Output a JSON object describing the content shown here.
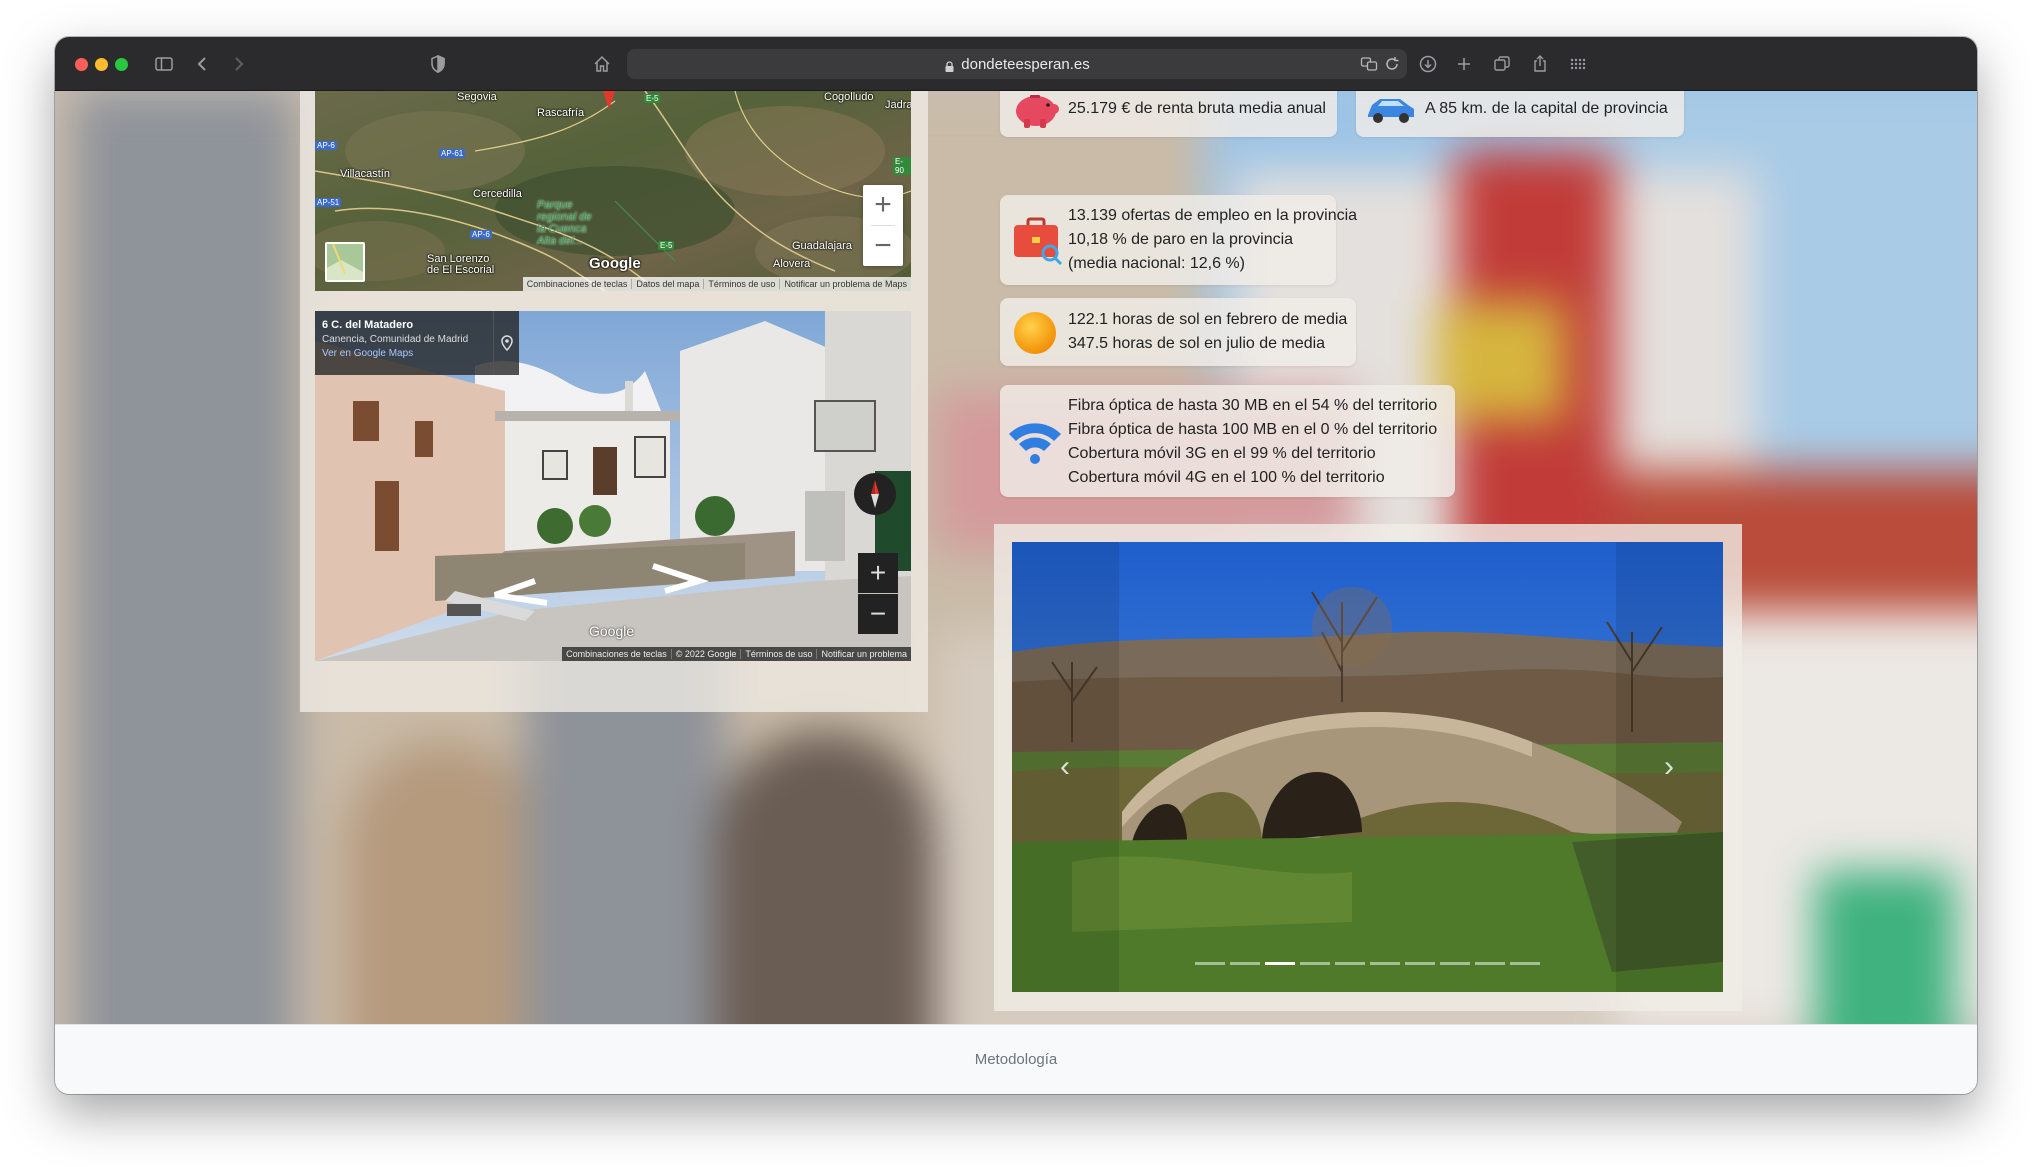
{
  "browser": {
    "url": "dondeteesperan.es"
  },
  "map": {
    "labels": {
      "segovia": "Segovia",
      "rascafria": "Rascafría",
      "cogolludo": "Cogolludo",
      "jadra": "Jadra",
      "villacastin": "Villacastín",
      "cercedilla": "Cercedilla",
      "parque": "Parque\nregional de\nla Cuenca\nAlta del...",
      "sanlorenzo": "San Lorenzo\nde El Escorial",
      "guadalajara": "Guadalajara",
      "alovera": "Alovera",
      "google": "Google"
    },
    "roads": {
      "ap6a": "AP-6",
      "ap61": "AP-61",
      "ap51": "AP-51",
      "ap6b": "AP-6",
      "e5a": "E-5",
      "e5b": "E-5",
      "e90": "E-90"
    },
    "zoom_in": "+",
    "zoom_out": "−",
    "footer": [
      "Combinaciones de teclas",
      "Datos del mapa",
      "Términos de uso",
      "Notificar un problema de Maps"
    ]
  },
  "streetview": {
    "title": "6 C. del Matadero",
    "subtitle": "Canencia, Comunidad de Madrid",
    "link": "Ver en Google Maps",
    "google": "Google",
    "zoom_in": "+",
    "zoom_out": "−",
    "footer": [
      "Combinaciones de teclas",
      "© 2022 Google",
      "Términos de uso",
      "Notificar un problema"
    ]
  },
  "cards": {
    "income": "25.179 € de renta bruta media anual",
    "distance": "A 85 km. de la capital de provincia",
    "jobs": [
      "13.139 ofertas de empleo en la provincia",
      "10,18 % de paro en la provincia",
      "(media nacional: 12,6 %)"
    ],
    "sun": [
      "122.1 horas de sol en febrero de media",
      "347.5 horas de sol en julio de media"
    ],
    "net": [
      "Fibra óptica de hasta 30 MB en el 54 % del territorio",
      "Fibra óptica de hasta 100 MB en el 0 % del territorio",
      "Cobertura móvil 3G en el 99 % del territorio",
      "Cobertura móvil 4G en el 100 % del territorio"
    ]
  },
  "carousel": {
    "prev": "‹",
    "next": "›",
    "slide_count": 10,
    "active_index": 2
  },
  "footer": {
    "link": "Metodología"
  },
  "colors": {
    "accent_blue": "#3b7dd8",
    "card_bg": "#f0ede8"
  }
}
